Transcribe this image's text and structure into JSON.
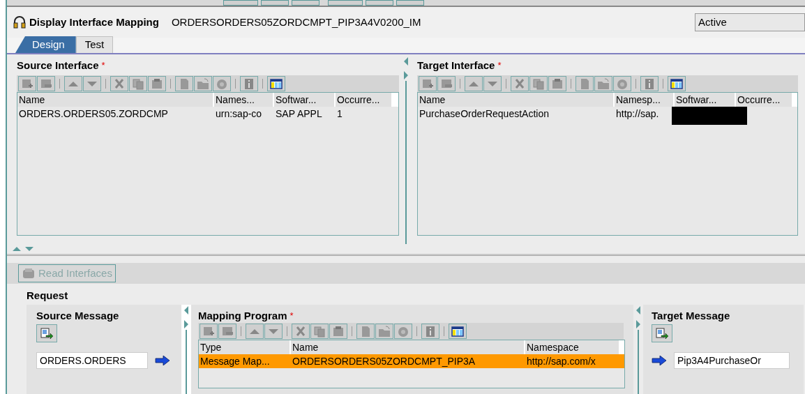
{
  "required_mark": "*",
  "header": {
    "title": "Display Interface Mapping",
    "object_name": "ORDERSORDERS05ZORDCMPT_PIP3A4V0200_IM",
    "status": "Active"
  },
  "tabs": [
    {
      "label": "Design",
      "selected": true
    },
    {
      "label": "Test",
      "selected": false
    }
  ],
  "source_interface": {
    "title": "Source Interface",
    "required": true,
    "columns": [
      "Name",
      "Names...",
      "Softwar...",
      "Occurre..."
    ],
    "rows": [
      {
        "cells": [
          "ORDERS.ORDERS05.ZORDCMP",
          "urn:sap-co",
          "SAP APPL",
          "1"
        ]
      }
    ]
  },
  "target_interface": {
    "title": "Target Interface",
    "required": true,
    "columns": [
      "Name",
      "Namesp...",
      "Softwar...",
      "Occurre..."
    ],
    "rows": [
      {
        "cells": [
          "PurchaseOrderRequestAction",
          "http://sap."
        ],
        "redacted": true
      }
    ]
  },
  "read_interfaces_button": {
    "label": "Read Interfaces",
    "disabled": true
  },
  "request": {
    "label": "Request",
    "source_message": {
      "title": "Source Message",
      "value": "ORDERS.ORDERS"
    },
    "mapping_program": {
      "title": "Mapping Program",
      "required": true,
      "columns": [
        "Type",
        "Name",
        "Namespace"
      ],
      "rows": [
        {
          "cells": [
            "Message Map...",
            "ORDERSORDERS05ZORDCMPT_PIP3A",
            "http://sap.com/x"
          ],
          "selected": true
        }
      ]
    },
    "target_message": {
      "title": "Target Message",
      "value": "Pip3A4PurchaseOr"
    }
  }
}
